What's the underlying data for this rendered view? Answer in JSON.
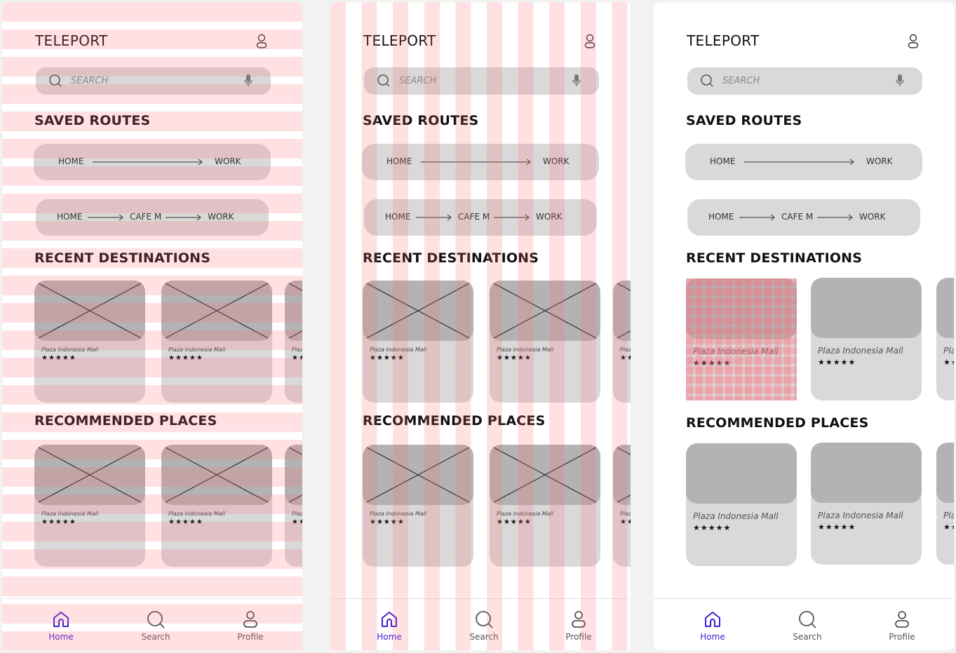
{
  "app": {
    "title": "TELEPORT"
  },
  "search": {
    "placeholder": "SEARCH"
  },
  "sections": {
    "saved_routes": "SAVED ROUTES",
    "recent_destinations": "RECENT DESTINATIONS",
    "recommended_places": "RECOMMENDED PLACES"
  },
  "routes": [
    {
      "stops": [
        "HOME",
        "WORK"
      ]
    },
    {
      "stops": [
        "HOME",
        "CAFE M",
        "WORK"
      ]
    }
  ],
  "place": {
    "name": "Plaza Indonesia Mall",
    "rating_stars": "★★★★★",
    "truncated_name": "Plaz",
    "truncated_name_big": "Pla",
    "truncated_stars": "★★"
  },
  "nav": [
    {
      "label": "Home",
      "icon": "home-icon",
      "active": true
    },
    {
      "label": "Search",
      "icon": "search-icon",
      "active": false
    },
    {
      "label": "Profile",
      "icon": "profile-icon",
      "active": false
    }
  ],
  "colors": {
    "accent": "#3d1fd6",
    "card": "#d9d9d9",
    "image_placeholder": "#b3b3b3",
    "grid_overlay": "#ff6978"
  }
}
